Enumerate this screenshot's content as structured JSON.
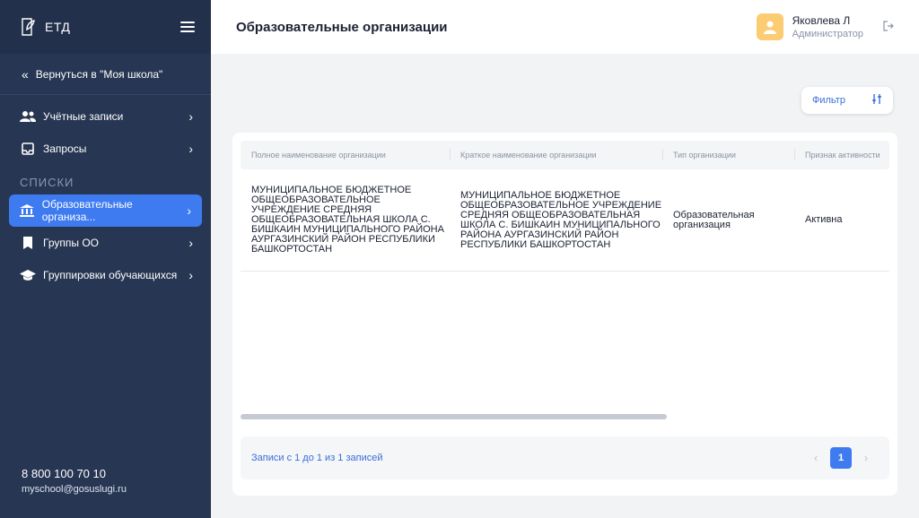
{
  "app": {
    "logo_text": "ЕТД"
  },
  "sidebar": {
    "back_label": "Вернуться в \"Моя школа\"",
    "items": [
      {
        "label": "Учётные записи",
        "icon": "users-icon"
      },
      {
        "label": "Запросы",
        "icon": "inbox-icon"
      }
    ],
    "section_label": "СПИСКИ",
    "list_items": [
      {
        "label": "Образовательные организа...",
        "icon": "institution-icon",
        "active": true
      },
      {
        "label": "Группы ОО",
        "icon": "bookmark-icon"
      },
      {
        "label": "Группировки обучающихся",
        "icon": "graduation-cap-icon"
      }
    ],
    "phone": "8 800 100 70 10",
    "email": "myschool@gosuslugi.ru"
  },
  "header": {
    "title": "Образовательные организации",
    "user_name": "Яковлева Л",
    "user_role": "Администратор"
  },
  "filter": {
    "label": "Фильтр"
  },
  "table": {
    "columns": [
      "Полное наименование организации",
      "Краткое наименование организации",
      "Тип организации",
      "Признак активности"
    ],
    "rows": [
      {
        "full_name": "МУНИЦИПАЛЬНОЕ БЮДЖЕТНОЕ ОБЩЕОБРАЗОВАТЕЛЬНОЕ УЧРЕЖДЕНИЕ СРЕДНЯЯ ОБЩЕОБРАЗОВАТЕЛЬНАЯ ШКОЛА С. БИШКАИН МУНИЦИПАЛЬНОГО РАЙОНА АУРГАЗИНСКИЙ РАЙОН РЕСПУБЛИКИ БАШКОРТОСТАН",
        "short_name": "МУНИЦИПАЛЬНОЕ БЮДЖЕТНОЕ ОБЩЕОБРАЗОВАТЕЛЬНОЕ УЧРЕЖДЕНИЕ СРЕДНЯЯ ОБЩЕОБРАЗОВАТЕЛЬНАЯ ШКОЛА С. БИШКАИН МУНИЦИПАЛЬНОГО РАЙОНА АУРГАЗИНСКИЙ РАЙОН РЕСПУБЛИКИ БАШКОРТОСТАН",
        "type": "Образовательная организация",
        "status": "Активна"
      }
    ]
  },
  "pagination": {
    "records_text": "Записи с 1 до 1 из 1 записей",
    "current_page": "1",
    "prev": "‹",
    "next": "›"
  },
  "colors": {
    "accent": "#3e7bf0",
    "sidebar": "#273653",
    "avatar": "#fccc72"
  }
}
